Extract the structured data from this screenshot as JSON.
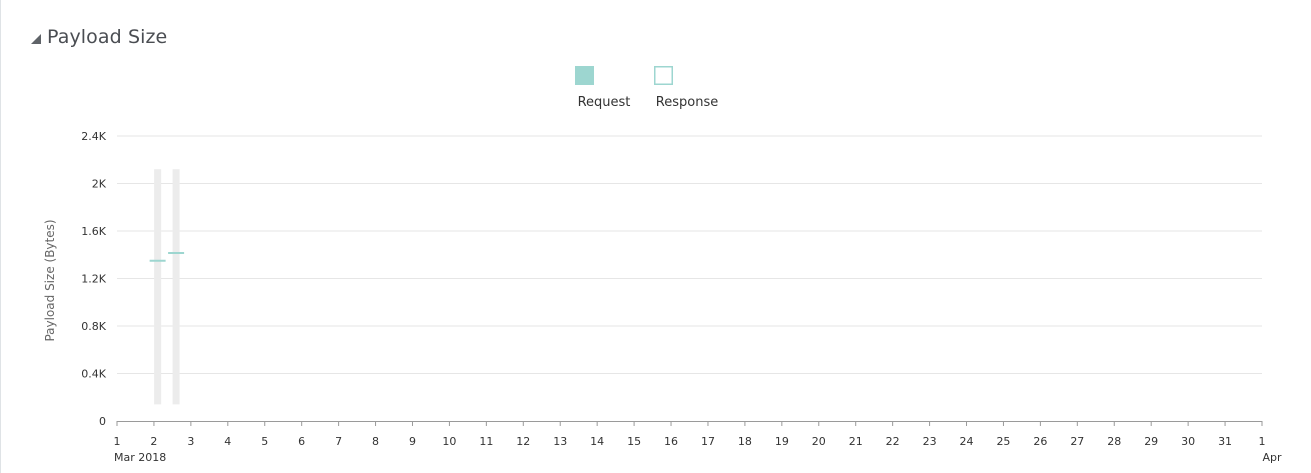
{
  "section": {
    "title": "Payload Size"
  },
  "colors": {
    "request": "#9dd6d0",
    "response_stroke": "#9dd6d0",
    "range_bar": "#ececec",
    "gridline": "#e6e6e6",
    "axis": "#9a9a9a"
  },
  "chart_data": {
    "type": "bar",
    "title": "",
    "ylabel": "Payload Size (Bytes)",
    "xlabel": "",
    "ylim": [
      0,
      2400
    ],
    "y_ticks": [
      {
        "value": 0,
        "label": "0"
      },
      {
        "value": 400,
        "label": "0.4K"
      },
      {
        "value": 800,
        "label": "0.8K"
      },
      {
        "value": 1200,
        "label": "1.2K"
      },
      {
        "value": 1600,
        "label": "1.6K"
      },
      {
        "value": 2000,
        "label": "2K"
      },
      {
        "value": 2400,
        "label": "2.4K"
      }
    ],
    "x_ticks": [
      "1",
      "2",
      "3",
      "4",
      "5",
      "6",
      "7",
      "8",
      "9",
      "10",
      "11",
      "12",
      "13",
      "14",
      "15",
      "16",
      "17",
      "18",
      "19",
      "20",
      "21",
      "22",
      "23",
      "24",
      "25",
      "26",
      "27",
      "28",
      "29",
      "30",
      "31",
      "1"
    ],
    "x_sublabels": [
      {
        "index": 0,
        "label": "Mar 2018"
      },
      {
        "index": 31,
        "label": "Apr"
      }
    ],
    "legend": {
      "position": "top-center",
      "items": [
        {
          "name": "Request",
          "style": "filled"
        },
        {
          "name": "Response",
          "style": "outline"
        }
      ]
    },
    "grid": true,
    "points": [
      {
        "day": 2.1,
        "range_low": 140,
        "range_high": 2120,
        "value": 1350,
        "series": "Request"
      },
      {
        "day": 2.6,
        "range_low": 140,
        "range_high": 2120,
        "value": 1415,
        "series": "Request"
      }
    ]
  }
}
